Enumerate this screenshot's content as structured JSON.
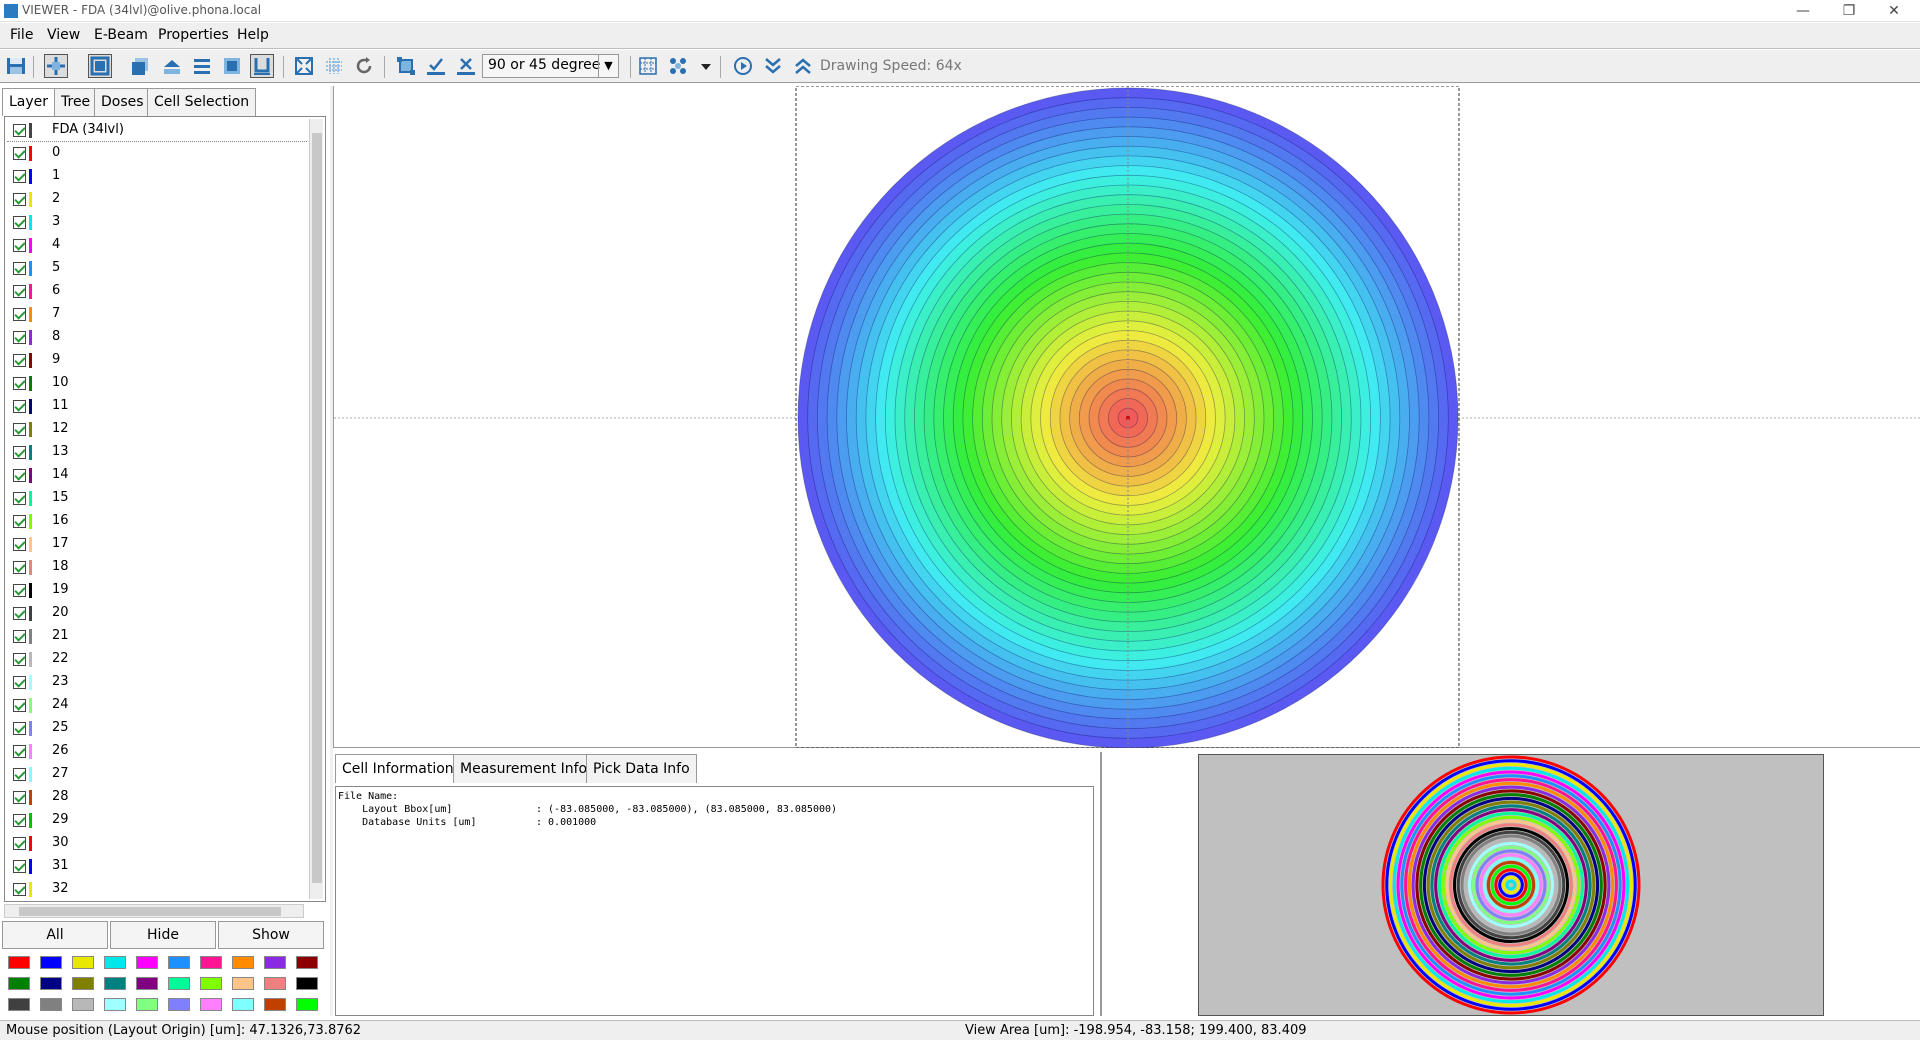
{
  "window": {
    "title": "VIEWER - FDA (34lvl)@olive.phona.local",
    "icon": "app-icon",
    "controls": [
      "minimize-icon",
      "restore-icon",
      "close-icon"
    ],
    "controls_glyphs": {
      "minimize": "—",
      "restore": "❐",
      "close": "✕"
    }
  },
  "menu": {
    "items": [
      {
        "label": "File"
      },
      {
        "label": "View"
      },
      {
        "label": "E-Beam"
      },
      {
        "label": "Properties"
      },
      {
        "label": "Help"
      }
    ]
  },
  "toolbar": {
    "buttons": [
      "save-icon",
      "select-icon",
      "frame-icon",
      "layer-stack-icon",
      "layer-up-icon",
      "layer-list-icon",
      "layer-fill-icon",
      "outline-u-icon",
      "zoom-fit-icon",
      "zoom-grid-icon",
      "refresh-icon",
      "select-all-icon",
      "check-icon",
      "uncheck-icon",
      "grid-icon",
      "pattern-icon",
      "dropdown-icon",
      "play-icon",
      "speed-down-icon",
      "speed-up-icon"
    ],
    "angle_select": {
      "value": "90 or 45 degree"
    },
    "drawing_speed": "Drawing Speed: 64x"
  },
  "left_tabs": [
    {
      "label": "Layer",
      "active": true
    },
    {
      "label": "Tree",
      "active": false
    },
    {
      "label": "Doses",
      "active": false
    },
    {
      "label": "Cell Selection",
      "active": false
    }
  ],
  "layers": {
    "root": "FDA (34lvl)",
    "items": [
      {
        "name": "0",
        "color": "#ff0000"
      },
      {
        "name": "1",
        "color": "#0000ff"
      },
      {
        "name": "2",
        "color": "#e8e800"
      },
      {
        "name": "3",
        "color": "#00e8e8"
      },
      {
        "name": "4",
        "color": "#ff00ff"
      },
      {
        "name": "5",
        "color": "#1e90ff"
      },
      {
        "name": "6",
        "color": "#ff1493"
      },
      {
        "name": "7",
        "color": "#ff8c00"
      },
      {
        "name": "8",
        "color": "#8a2be2"
      },
      {
        "name": "9",
        "color": "#8b0000"
      },
      {
        "name": "10",
        "color": "#008000"
      },
      {
        "name": "11",
        "color": "#000080"
      },
      {
        "name": "12",
        "color": "#808000"
      },
      {
        "name": "13",
        "color": "#008080"
      },
      {
        "name": "14",
        "color": "#800080"
      },
      {
        "name": "15",
        "color": "#00fa9a"
      },
      {
        "name": "16",
        "color": "#7fff00"
      },
      {
        "name": "17",
        "color": "#ffc48a"
      },
      {
        "name": "18",
        "color": "#f08080"
      },
      {
        "name": "19",
        "color": "#000000"
      },
      {
        "name": "20",
        "color": "#404040"
      },
      {
        "name": "21",
        "color": "#808080"
      },
      {
        "name": "22",
        "color": "#b8b8b8"
      },
      {
        "name": "23",
        "color": "#a0ffff"
      },
      {
        "name": "24",
        "color": "#80ff80"
      },
      {
        "name": "25",
        "color": "#8080ff"
      },
      {
        "name": "26",
        "color": "#ff80ff"
      },
      {
        "name": "27",
        "color": "#80ffff"
      },
      {
        "name": "28",
        "color": "#c04000"
      },
      {
        "name": "29",
        "color": "#00c000"
      },
      {
        "name": "30",
        "color": "#ff0000"
      },
      {
        "name": "31",
        "color": "#0000ff"
      },
      {
        "name": "32",
        "color": "#e8e800"
      }
    ]
  },
  "layer_buttons": {
    "all": "All",
    "hide": "Hide",
    "show": "Show"
  },
  "palette": [
    "#ff0000",
    "#0000ff",
    "#e8e800",
    "#00e8e8",
    "#ff00ff",
    "#1e90ff",
    "#ff1493",
    "#ff8c00",
    "#8a2be2",
    "#8b0000",
    "#008000",
    "#000080",
    "#808000",
    "#008080",
    "#800080",
    "#00fa9a",
    "#7fff00",
    "#ffc48a",
    "#f08080",
    "#000000",
    "#404040",
    "#808080",
    "#b8b8b8",
    "#a0ffff",
    "#80ff80",
    "#8080ff",
    "#ff80ff",
    "#80ffff",
    "#c04000",
    "#00ff00"
  ],
  "bottom_tabs": [
    {
      "label": "Cell Information",
      "active": true
    },
    {
      "label": "Measurement Info",
      "active": false
    },
    {
      "label": "Pick Data Info",
      "active": false
    }
  ],
  "cell_info": {
    "file_name": "File Name:",
    "bbox_label": "    Layout Bbox[um]",
    "bbox_value": ": (-83.085000, -83.085000), (83.085000, 83.085000)",
    "units_label": "    Database Units [um]",
    "units_value": ": 0.001000"
  },
  "status": {
    "mouse": "Mouse position (Layout Origin) [um]: 47.1326,73.8762",
    "view_area": "View Area [um]: -198.954, -83.158; 199.400, 83.409"
  }
}
